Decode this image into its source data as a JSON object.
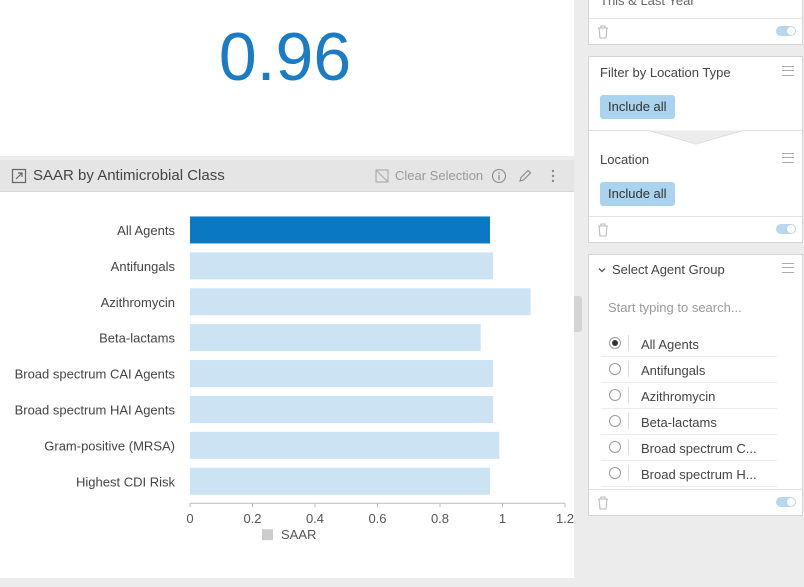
{
  "kpi": {
    "value": "0.96"
  },
  "chart_panel": {
    "title": "SAAR by Antimicrobial Class",
    "clear_selection_label": "Clear Selection"
  },
  "chart_data": {
    "type": "bar",
    "orientation": "horizontal",
    "categories": [
      "All Agents",
      "Antifungals",
      "Azithromycin",
      "Beta-lactams",
      "Broad spectrum CAI Agents",
      "Broad spectrum HAI Agents",
      "Gram-positive (MRSA)",
      "Highest CDI Risk"
    ],
    "series": [
      {
        "name": "SAAR",
        "values": [
          0.96,
          0.97,
          1.09,
          0.93,
          0.97,
          0.97,
          0.99,
          0.96
        ]
      }
    ],
    "selected_category": "All Agents",
    "xlim": [
      0,
      1.2
    ],
    "xticks": [
      "0",
      "0.2",
      "0.4",
      "0.6",
      "0.8",
      "1",
      "1.2"
    ],
    "legend": "bottom",
    "colors": {
      "selected": "#0a78c2",
      "unselected": "#cce3f4"
    }
  },
  "location_type_filter": {
    "partial_title": "This & Last Year",
    "title": "Filter by Location Type",
    "chip": "Include all",
    "location_title": "Location",
    "location_chip": "Include all"
  },
  "agent_group": {
    "title": "Select Agent Group",
    "search_placeholder": "Start typing to search...",
    "options": [
      {
        "label": "All Agents",
        "selected": true
      },
      {
        "label": "Antifungals",
        "selected": false
      },
      {
        "label": "Azithromycin",
        "selected": false
      },
      {
        "label": "Beta-lactams",
        "selected": false
      },
      {
        "label": "Broad spectrum C...",
        "selected": false
      },
      {
        "label": "Broad spectrum H...",
        "selected": false
      }
    ]
  },
  "icons": [
    "expand-icon",
    "clear-selection-icon",
    "info-icon",
    "pencil-icon",
    "kebab-menu-icon",
    "trash-icon",
    "toggle-icon",
    "hamburger-menu-icon",
    "chevron-down-icon"
  ]
}
